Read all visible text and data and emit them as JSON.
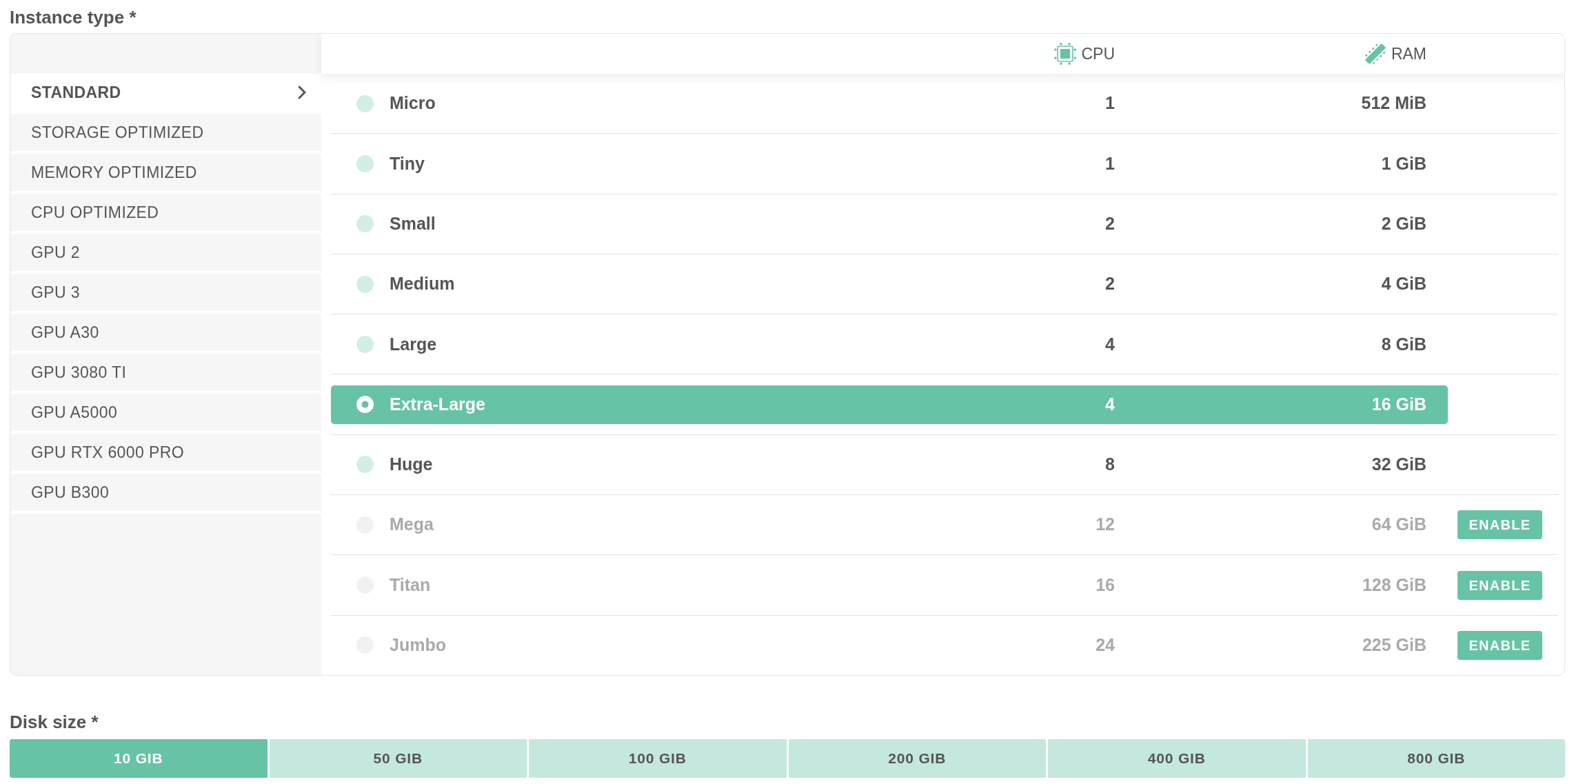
{
  "instance_type": {
    "label": "Instance type *",
    "categories": [
      {
        "label": "STANDARD",
        "selected": true
      },
      {
        "label": "STORAGE OPTIMIZED",
        "selected": false
      },
      {
        "label": "MEMORY OPTIMIZED",
        "selected": false
      },
      {
        "label": "CPU OPTIMIZED",
        "selected": false
      },
      {
        "label": "GPU 2",
        "selected": false
      },
      {
        "label": "GPU 3",
        "selected": false
      },
      {
        "label": "GPU A30",
        "selected": false
      },
      {
        "label": "GPU 3080 TI",
        "selected": false
      },
      {
        "label": "GPU A5000",
        "selected": false
      },
      {
        "label": "GPU RTX 6000 PRO",
        "selected": false
      },
      {
        "label": "GPU B300",
        "selected": false
      }
    ],
    "columns": [
      {
        "kind": "cpu",
        "label": "CPU"
      },
      {
        "kind": "ram",
        "label": "RAM"
      }
    ],
    "options": [
      {
        "name": "Micro",
        "cpu": "1",
        "ram": "512 MiB",
        "selected": false,
        "disabled": false
      },
      {
        "name": "Tiny",
        "cpu": "1",
        "ram": "1 GiB",
        "selected": false,
        "disabled": false
      },
      {
        "name": "Small",
        "cpu": "2",
        "ram": "2 GiB",
        "selected": false,
        "disabled": false
      },
      {
        "name": "Medium",
        "cpu": "2",
        "ram": "4 GiB",
        "selected": false,
        "disabled": false
      },
      {
        "name": "Large",
        "cpu": "4",
        "ram": "8 GiB",
        "selected": false,
        "disabled": false
      },
      {
        "name": "Extra-Large",
        "cpu": "4",
        "ram": "16 GiB",
        "selected": true,
        "disabled": false
      },
      {
        "name": "Huge",
        "cpu": "8",
        "ram": "32 GiB",
        "selected": false,
        "disabled": false
      },
      {
        "name": "Mega",
        "cpu": "12",
        "ram": "64 GiB",
        "selected": false,
        "disabled": true,
        "action": "ENABLE"
      },
      {
        "name": "Titan",
        "cpu": "16",
        "ram": "128 GiB",
        "selected": false,
        "disabled": true,
        "action": "ENABLE"
      },
      {
        "name": "Jumbo",
        "cpu": "24",
        "ram": "225 GiB",
        "selected": false,
        "disabled": true,
        "action": "ENABLE"
      }
    ]
  },
  "disk_size": {
    "label": "Disk size *",
    "options": [
      {
        "label": "10 GIB",
        "selected": true
      },
      {
        "label": "50 GIB",
        "selected": false
      },
      {
        "label": "100 GIB",
        "selected": false
      },
      {
        "label": "200 GIB",
        "selected": false
      },
      {
        "label": "400 GIB",
        "selected": false
      },
      {
        "label": "800 GIB",
        "selected": false
      }
    ]
  }
}
